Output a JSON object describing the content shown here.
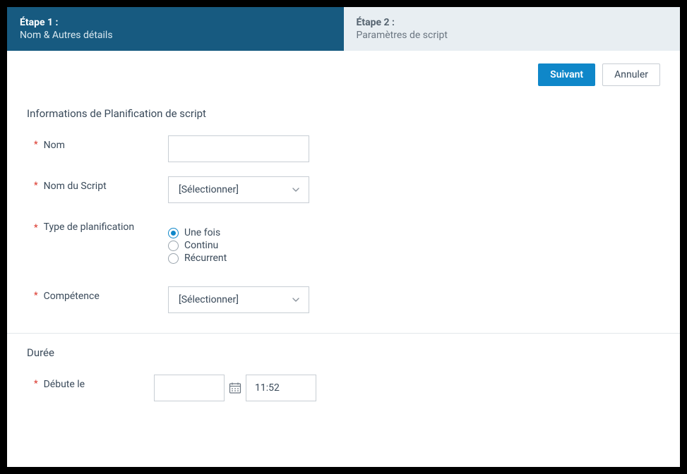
{
  "steps": {
    "step1": {
      "title": "Étape 1 :",
      "sub": "Nom & Autres détails"
    },
    "step2": {
      "title": "Étape 2 :",
      "sub": "Paramètres de script"
    }
  },
  "actions": {
    "next": "Suivant",
    "cancel": "Annuler"
  },
  "section_info": {
    "title": "Informations de Planification de script",
    "fields": {
      "name_label": "Nom",
      "script_label": "Nom du Script",
      "script_placeholder": "[Sélectionner]",
      "schedtype_label": "Type de planification",
      "schedtype_options": {
        "once": "Une fois",
        "continuous": "Continu",
        "recurring": "Récurrent"
      },
      "schedtype_selected": "once",
      "skill_label": "Compétence",
      "skill_placeholder": "[Sélectionner]"
    }
  },
  "section_duration": {
    "title": "Durée",
    "fields": {
      "start_label": "Débute le",
      "time_value": "11:52"
    }
  }
}
